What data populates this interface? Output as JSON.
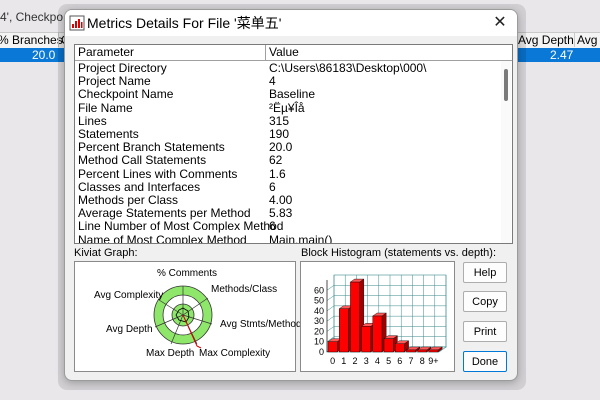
{
  "background": {
    "title_fragment": "4', Checkpo",
    "headers": [
      "% Branches",
      "C",
      "Avg Depth",
      "Avg C"
    ],
    "row_values": [
      "20.0",
      "2.47"
    ]
  },
  "dialog": {
    "title": "Metrics Details For File '菜单五'",
    "close_symbol": "✕",
    "table": {
      "columns": [
        "Parameter",
        "Value"
      ],
      "rows": [
        {
          "param": "Project Directory",
          "value": "C:\\Users\\86183\\Desktop\\000\\"
        },
        {
          "param": "Project Name",
          "value": "4"
        },
        {
          "param": "Checkpoint Name",
          "value": "Baseline"
        },
        {
          "param": "File Name",
          "value": "²Ëµ¥Îå"
        },
        {
          "param": "Lines",
          "value": "315"
        },
        {
          "param": "Statements",
          "value": "190"
        },
        {
          "param": "Percent Branch Statements",
          "value": "20.0"
        },
        {
          "param": "Method Call Statements",
          "value": "62"
        },
        {
          "param": "Percent Lines with Comments",
          "value": "1.6"
        },
        {
          "param": "Classes and Interfaces",
          "value": "6"
        },
        {
          "param": "Methods per Class",
          "value": "4.00"
        },
        {
          "param": "Average Statements per Method",
          "value": "5.83"
        },
        {
          "param": "Line Number of Most Complex Method",
          "value": "6"
        },
        {
          "param": "Name of Most Complex Method",
          "value": "Main.main()"
        }
      ]
    },
    "kiviat": {
      "label": "Kiviat Graph:",
      "axes": [
        "% Comments",
        "Methods/Class",
        "Avg Stmts/Method",
        "Max Complexity",
        "Max Depth",
        "Avg Depth",
        "Avg Complexity"
      ]
    },
    "histogram": {
      "label": "Block Histogram (statements vs. depth):"
    },
    "buttons": {
      "help": "Help",
      "copy": "Copy",
      "print": "Print",
      "done": "Done"
    }
  },
  "chart_data": {
    "type": "bar",
    "title": "Block Histogram (statements vs. depth):",
    "categories": [
      "0",
      "1",
      "2",
      "3",
      "4",
      "5",
      "6",
      "7",
      "8",
      "9+"
    ],
    "values": [
      10,
      42,
      68,
      25,
      35,
      13,
      8,
      2,
      2,
      2
    ],
    "ylim": [
      0,
      70
    ],
    "yticks": [
      0,
      10,
      20,
      30,
      40,
      50,
      60
    ],
    "color": "#ff0000",
    "grid": true
  }
}
